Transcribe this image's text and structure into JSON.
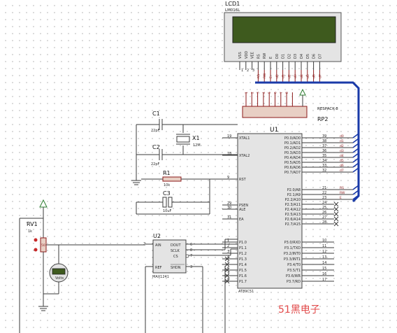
{
  "lcd": {
    "ref": "LCD1",
    "model": "LM016L",
    "pins": [
      "VSS",
      "VDD",
      "VEE",
      "RS",
      "RW",
      "E",
      "D0",
      "D1",
      "D2",
      "D3",
      "D4",
      "D5",
      "D6",
      "D7"
    ],
    "net_labels": [
      "",
      "",
      "",
      "RS",
      "RW",
      "E",
      "d0",
      "d1",
      "d2",
      "d3",
      "d4",
      "d5",
      "d6",
      "d7"
    ],
    "colors": {
      "body": "#e4e4e4",
      "screen": "#3e5a1e"
    }
  },
  "resistor_pack": {
    "ref": "RP2",
    "part": "RESPACK-8"
  },
  "mcu": {
    "ref": "U1",
    "part": "AT89C51",
    "left_pins": [
      {
        "name": "XTAL1",
        "num": "19"
      },
      {
        "name": "XTAL2",
        "num": "18"
      },
      {
        "name": "RST",
        "num": "9"
      },
      {
        "name": "PSEN",
        "num": "29"
      },
      {
        "name": "ALE",
        "num": "30"
      },
      {
        "name": "EA",
        "num": "31"
      },
      {
        "name": "P1.0",
        "num": "1"
      },
      {
        "name": "P1.1",
        "num": "2"
      },
      {
        "name": "P1.2",
        "num": "3"
      },
      {
        "name": "P1.3",
        "num": "4"
      },
      {
        "name": "P1.4",
        "num": "5"
      },
      {
        "name": "P1.5",
        "num": "6"
      },
      {
        "name": "P1.6",
        "num": "7"
      },
      {
        "name": "P1.7",
        "num": "8"
      }
    ],
    "right_pins_p0": [
      {
        "name": "P0.0/AD0",
        "num": "39",
        "net": "d0"
      },
      {
        "name": "P0.1/AD1",
        "num": "38",
        "net": "d1"
      },
      {
        "name": "P0.2/AD2",
        "num": "37",
        "net": "d2"
      },
      {
        "name": "P0.3/AD3",
        "num": "36",
        "net": "d3"
      },
      {
        "name": "P0.4/AD4",
        "num": "35",
        "net": "d4"
      },
      {
        "name": "P0.5/AD5",
        "num": "34",
        "net": "d5"
      },
      {
        "name": "P0.6/AD6",
        "num": "33",
        "net": "d6"
      },
      {
        "name": "P0.7/AD7",
        "num": "32",
        "net": "d7"
      }
    ],
    "right_pins_p2": [
      {
        "name": "P2.0/A8",
        "num": "21",
        "net": "RS"
      },
      {
        "name": "P2.1/A9",
        "num": "22",
        "net": "RW"
      },
      {
        "name": "P2.2/A10",
        "num": "23",
        "net": "E"
      },
      {
        "name": "P2.3/A11",
        "num": "24",
        "net": ""
      },
      {
        "name": "P2.4/A12",
        "num": "25",
        "net": ""
      },
      {
        "name": "P2.5/A13",
        "num": "26",
        "net": ""
      },
      {
        "name": "P2.6/A14",
        "num": "27",
        "net": ""
      },
      {
        "name": "P2.7/A15",
        "num": "28",
        "net": ""
      }
    ],
    "right_pins_p3": [
      {
        "name": "P3.0/RXD",
        "num": "10"
      },
      {
        "name": "P3.1/TXD",
        "num": "11"
      },
      {
        "name": "P3.2/INT0",
        "num": "12"
      },
      {
        "name": "P3.3/INT1",
        "num": "13"
      },
      {
        "name": "P3.4/T0",
        "num": "14"
      },
      {
        "name": "P3.5/T1",
        "num": "15"
      },
      {
        "name": "P3.6/WR",
        "num": "16"
      },
      {
        "name": "P3.7/RD",
        "num": "17"
      }
    ]
  },
  "adc": {
    "ref": "U2",
    "part": "MAX1241",
    "left_pins": [
      "AIN",
      "REF"
    ],
    "right_pins": [
      "DOUT",
      "SCLK",
      "CS",
      "SHDN"
    ],
    "pin_nums": {
      "AIN": "2",
      "DOUT": "6",
      "SCLK": "8",
      "CS": "7",
      "SHDN": "3"
    }
  },
  "components": {
    "c1": {
      "ref": "C1",
      "value": "22pF"
    },
    "c2": {
      "ref": "C2",
      "value": "22pF"
    },
    "c3": {
      "ref": "C3",
      "value": "10uF"
    },
    "x1": {
      "ref": "X1",
      "value": "12M"
    },
    "r1": {
      "ref": "R1",
      "value": "10k"
    },
    "rv1": {
      "ref": "RV1",
      "value": "1k",
      "wiper_pct": "50"
    },
    "voltmeter": {
      "unit": "Volts",
      "reading": ""
    }
  },
  "brand": "51黑电子"
}
